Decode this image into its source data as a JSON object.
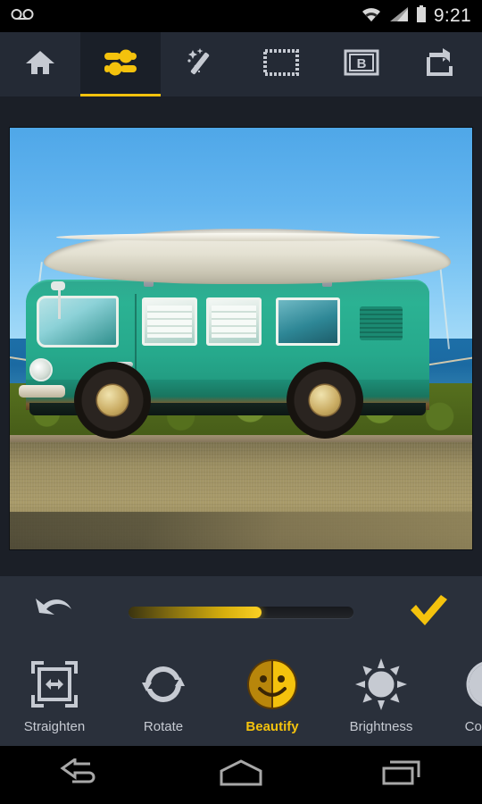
{
  "statusbar": {
    "clock": "9:21",
    "icons": [
      "voicemail-icon",
      "wifi-icon",
      "cellular-signal-icon",
      "battery-icon"
    ]
  },
  "toolbar": {
    "items": [
      {
        "name": "home",
        "icon": "home-icon",
        "active": false
      },
      {
        "name": "adjust",
        "icon": "sliders-icon",
        "active": true
      },
      {
        "name": "effects",
        "icon": "magic-wand-icon",
        "active": false
      },
      {
        "name": "frames",
        "icon": "frame-icon",
        "active": false
      },
      {
        "name": "text",
        "icon": "text-b-icon",
        "label": "B",
        "active": false
      },
      {
        "name": "share",
        "icon": "share-icon",
        "active": false
      }
    ]
  },
  "canvas": {
    "photo_alt": "Teal Volkswagen bus with white canoe on roof parked by the ocean"
  },
  "slider": {
    "undo_label": "Undo",
    "apply_label": "Apply",
    "value_percent": 59,
    "fill_color": "#f4c20d",
    "track_color": "#1a1c20"
  },
  "tools": [
    {
      "label": "Straighten",
      "icon": "straighten-icon",
      "active": false
    },
    {
      "label": "Rotate",
      "icon": "rotate-icon",
      "active": false
    },
    {
      "label": "Beautify",
      "icon": "beautify-smiley-icon",
      "active": true
    },
    {
      "label": "Brightness",
      "icon": "sun-icon",
      "active": false
    },
    {
      "label": "Contrast",
      "icon": "contrast-icon",
      "active": false
    }
  ],
  "navbar": {
    "items": [
      {
        "label": "Back",
        "icon": "back-arrow-icon"
      },
      {
        "label": "Home",
        "icon": "home-pentagon-icon"
      },
      {
        "label": "Recents",
        "icon": "recents-icon"
      }
    ]
  },
  "colors": {
    "accent": "#f4c20d",
    "chrome": "#2a303b",
    "toolbar": "#242a35",
    "canvas_bg": "#1b1f27",
    "icon": "#c6cad2"
  }
}
